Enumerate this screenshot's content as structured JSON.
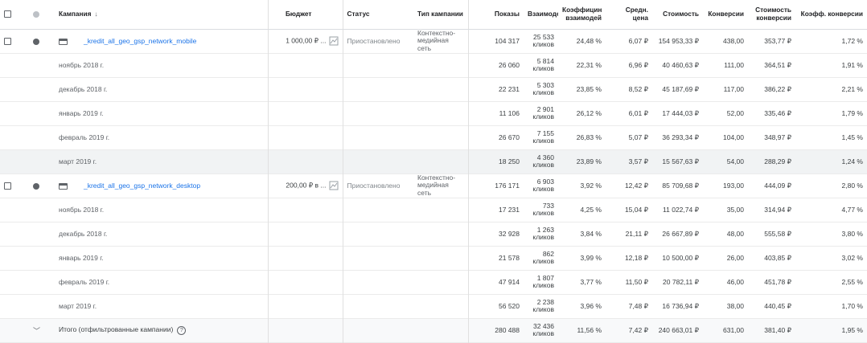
{
  "header": {
    "campaign": "Кампания",
    "budget": "Бюджет",
    "status": "Статус",
    "type": "Тип кампании",
    "impressions": "Показы",
    "interactions": "Взаимодей",
    "interaction_rate": "Коэффицин взаимодей",
    "avg_cost": "Средн. цена",
    "cost": "Стоимость",
    "conversions": "Конверсии",
    "cost_per_conv": "Стоимость конверсии",
    "conv_rate": "Коэфф. конверсии"
  },
  "campaigns": [
    {
      "name": "_kredit_all_geo_gsp_network_mobile",
      "budget": "1 000,00 ₽ ...",
      "status": "Приостановлено",
      "type": "Контекстно-медийная сеть",
      "impressions": "104 317",
      "interactions": "25 533",
      "interactions_unit": "кликов",
      "interaction_rate": "24,48 %",
      "avg_cost": "6,07 ₽",
      "cost": "154 953,33 ₽",
      "conversions": "438,00",
      "cost_per_conv": "353,77 ₽",
      "conv_rate": "1,72 %",
      "months": [
        {
          "label": "ноябрь 2018 г.",
          "impressions": "26 060",
          "interactions": "5 814",
          "unit": "кликов",
          "interaction_rate": "22,31 %",
          "avg_cost": "6,96 ₽",
          "cost": "40 460,63 ₽",
          "conversions": "111,00",
          "cost_per_conv": "364,51 ₽",
          "conv_rate": "1,91 %"
        },
        {
          "label": "декабрь 2018 г.",
          "impressions": "22 231",
          "interactions": "5 303",
          "unit": "кликов",
          "interaction_rate": "23,85 %",
          "avg_cost": "8,52 ₽",
          "cost": "45 187,69 ₽",
          "conversions": "117,00",
          "cost_per_conv": "386,22 ₽",
          "conv_rate": "2,21 %"
        },
        {
          "label": "январь 2019 г.",
          "impressions": "11 106",
          "interactions": "2 901",
          "unit": "кликов",
          "interaction_rate": "26,12 %",
          "avg_cost": "6,01 ₽",
          "cost": "17 444,03 ₽",
          "conversions": "52,00",
          "cost_per_conv": "335,46 ₽",
          "conv_rate": "1,79 %"
        },
        {
          "label": "февраль 2019 г.",
          "impressions": "26 670",
          "interactions": "7 155",
          "unit": "кликов",
          "interaction_rate": "26,83 %",
          "avg_cost": "5,07 ₽",
          "cost": "36 293,34 ₽",
          "conversions": "104,00",
          "cost_per_conv": "348,97 ₽",
          "conv_rate": "1,45 %"
        },
        {
          "label": "март 2019 г.",
          "impressions": "18 250",
          "interactions": "4 360",
          "unit": "кликов",
          "interaction_rate": "23,89 %",
          "avg_cost": "3,57 ₽",
          "cost": "15 567,63 ₽",
          "conversions": "54,00",
          "cost_per_conv": "288,29 ₽",
          "conv_rate": "1,24 %"
        }
      ]
    },
    {
      "name": "_kredit_all_geo_gsp_network_desktop",
      "budget": "200,00 ₽ в ...",
      "status": "Приостановлено",
      "type": "Контекстно-медийная сеть",
      "impressions": "176 171",
      "interactions": "6 903",
      "interactions_unit": "кликов",
      "interaction_rate": "3,92 %",
      "avg_cost": "12,42 ₽",
      "cost": "85 709,68 ₽",
      "conversions": "193,00",
      "cost_per_conv": "444,09 ₽",
      "conv_rate": "2,80 %",
      "months": [
        {
          "label": "ноябрь 2018 г.",
          "impressions": "17 231",
          "interactions": "733",
          "unit": "кликов",
          "interaction_rate": "4,25 %",
          "avg_cost": "15,04 ₽",
          "cost": "11 022,74 ₽",
          "conversions": "35,00",
          "cost_per_conv": "314,94 ₽",
          "conv_rate": "4,77 %"
        },
        {
          "label": "декабрь 2018 г.",
          "impressions": "32 928",
          "interactions": "1 263",
          "unit": "кликов",
          "interaction_rate": "3,84 %",
          "avg_cost": "21,11 ₽",
          "cost": "26 667,89 ₽",
          "conversions": "48,00",
          "cost_per_conv": "555,58 ₽",
          "conv_rate": "3,80 %"
        },
        {
          "label": "январь 2019 г.",
          "impressions": "21 578",
          "interactions": "862",
          "unit": "кликов",
          "interaction_rate": "3,99 %",
          "avg_cost": "12,18 ₽",
          "cost": "10 500,00 ₽",
          "conversions": "26,00",
          "cost_per_conv": "403,85 ₽",
          "conv_rate": "3,02 %"
        },
        {
          "label": "февраль 2019 г.",
          "impressions": "47 914",
          "interactions": "1 807",
          "unit": "кликов",
          "interaction_rate": "3,77 %",
          "avg_cost": "11,50 ₽",
          "cost": "20 782,11 ₽",
          "conversions": "46,00",
          "cost_per_conv": "451,78 ₽",
          "conv_rate": "2,55 %"
        },
        {
          "label": "март 2019 г.",
          "impressions": "56 520",
          "interactions": "2 238",
          "unit": "кликов",
          "interaction_rate": "3,96 %",
          "avg_cost": "7,48 ₽",
          "cost": "16 736,94 ₽",
          "conversions": "38,00",
          "cost_per_conv": "440,45 ₽",
          "conv_rate": "1,70 %"
        }
      ]
    }
  ],
  "total": {
    "label": "Итого (отфильтрованные кампании)",
    "impressions": "280 488",
    "interactions": "32 436",
    "unit": "кликов",
    "interaction_rate": "11,56 %",
    "avg_cost": "7,42 ₽",
    "cost": "240 663,01 ₽",
    "conversions": "631,00",
    "cost_per_conv": "381,40 ₽",
    "conv_rate": "1,95 %"
  },
  "icons": {
    "sort": "arrow-down-icon",
    "campaign_type": "display-network-icon",
    "budget": "chart-icon",
    "expand": "chevron-down-icon",
    "help": "help-icon"
  },
  "colors": {
    "link": "#1a73e8",
    "highlight_row": "#f1f3f4"
  }
}
